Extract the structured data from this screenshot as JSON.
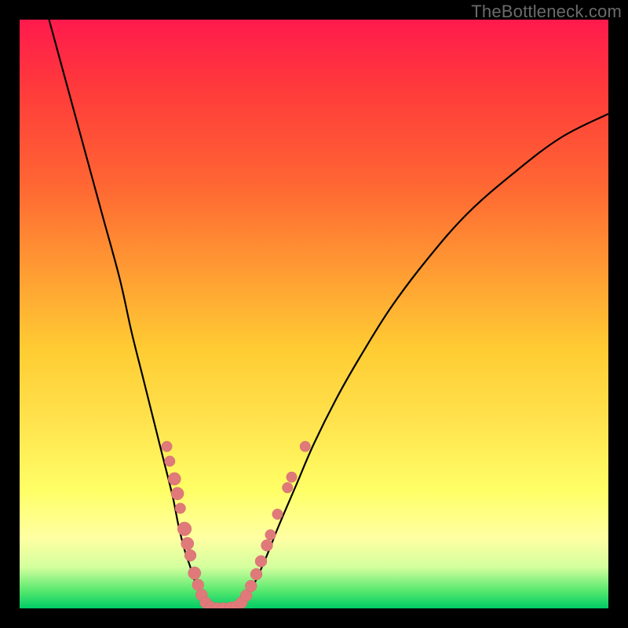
{
  "watermark": "TheBottleneck.com",
  "colors": {
    "background": "#000000",
    "curve_stroke": "#000000",
    "marker_fill": "#e07a7a",
    "marker_stroke": "#d46a6a"
  },
  "chart_data": {
    "type": "line",
    "title": "",
    "xlabel": "",
    "ylabel": "",
    "xlim": [
      0,
      100
    ],
    "ylim": [
      0,
      100
    ],
    "series": [
      {
        "name": "left-branch",
        "x": [
          5,
          8,
          11,
          14,
          17,
          19,
          21,
          23,
          24.5,
          26,
          27,
          28,
          29,
          29.8,
          30.5,
          31.2,
          31.8
        ],
        "y": [
          100,
          89,
          78,
          67,
          56,
          47,
          39,
          31,
          25,
          19,
          14,
          10,
          7,
          4.5,
          2.8,
          1.3,
          0.2
        ]
      },
      {
        "name": "valley-floor",
        "x": [
          31.8,
          33,
          34.5,
          36,
          37.2
        ],
        "y": [
          0.2,
          0,
          0,
          0,
          0.2
        ]
      },
      {
        "name": "right-branch",
        "x": [
          37.2,
          38.5,
          40,
          42,
          44,
          47,
          50,
          54,
          58,
          63,
          69,
          76,
          84,
          92,
          100
        ],
        "y": [
          0.2,
          1.8,
          4.5,
          9,
          14,
          21,
          28,
          36,
          43,
          51,
          59,
          67,
          74,
          80,
          84
        ]
      }
    ],
    "markers": [
      {
        "x": 25.0,
        "y": 27.5,
        "r": 1.0
      },
      {
        "x": 25.5,
        "y": 25.0,
        "r": 1.0
      },
      {
        "x": 26.3,
        "y": 22.0,
        "r": 1.2
      },
      {
        "x": 26.8,
        "y": 19.5,
        "r": 1.2
      },
      {
        "x": 27.3,
        "y": 17.0,
        "r": 1.0
      },
      {
        "x": 28.0,
        "y": 13.5,
        "r": 1.3
      },
      {
        "x": 28.5,
        "y": 11.0,
        "r": 1.2
      },
      {
        "x": 29.0,
        "y": 9.0,
        "r": 1.1
      },
      {
        "x": 29.7,
        "y": 6.0,
        "r": 1.2
      },
      {
        "x": 30.3,
        "y": 4.0,
        "r": 1.1
      },
      {
        "x": 30.9,
        "y": 2.3,
        "r": 1.1
      },
      {
        "x": 31.6,
        "y": 1.0,
        "r": 1.1
      },
      {
        "x": 32.5,
        "y": 0.2,
        "r": 1.1
      },
      {
        "x": 33.5,
        "y": 0.0,
        "r": 1.1
      },
      {
        "x": 34.6,
        "y": 0.0,
        "r": 1.1
      },
      {
        "x": 35.8,
        "y": 0.1,
        "r": 1.1
      },
      {
        "x": 36.8,
        "y": 0.3,
        "r": 1.1
      },
      {
        "x": 37.7,
        "y": 1.0,
        "r": 1.1
      },
      {
        "x": 38.5,
        "y": 2.2,
        "r": 1.1
      },
      {
        "x": 39.3,
        "y": 3.8,
        "r": 1.1
      },
      {
        "x": 40.2,
        "y": 5.8,
        "r": 1.1
      },
      {
        "x": 41.0,
        "y": 8.0,
        "r": 1.1
      },
      {
        "x": 42.0,
        "y": 10.7,
        "r": 1.1
      },
      {
        "x": 42.6,
        "y": 12.5,
        "r": 1.0
      },
      {
        "x": 43.8,
        "y": 16.0,
        "r": 1.0
      },
      {
        "x": 45.5,
        "y": 20.5,
        "r": 1.0
      },
      {
        "x": 46.2,
        "y": 22.3,
        "r": 1.0
      },
      {
        "x": 48.5,
        "y": 27.5,
        "r": 1.0
      }
    ]
  }
}
